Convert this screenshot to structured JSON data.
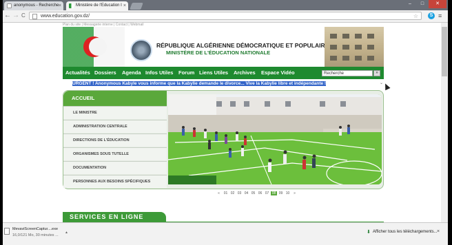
{
  "browser": {
    "tabs": [
      {
        "label": "anonymous - Recherche"
      },
      {
        "label": "Ministère de l'Education I"
      }
    ],
    "tab_close": "×",
    "new_tab": "",
    "window_controls": {
      "minimize": "–",
      "maximize": "□",
      "close": "✕"
    },
    "nav": {
      "back": "←",
      "forward": "→",
      "reload": "C"
    },
    "url": "www.education.gov.dz/",
    "bookmark_star": "☆",
    "skype": "S",
    "menu": "≡"
  },
  "site": {
    "toplinks": "Plan du site | Messagerie interne | Contact | Webmail",
    "title_line1": "République Algérienne Démocratique et Populaire",
    "title_line2": "Ministère de l'Éducation Nationale",
    "nav_items": [
      "Actualités",
      "Dossiers",
      "Agenda",
      "Infos Utiles",
      "Forum",
      "Liens Utiles",
      "Archives",
      "Espace Vidéo"
    ],
    "search_value": "Recherche",
    "search_button": "»",
    "ticker": "URGENT ! Anonymous Kabyle vous informe que la Kabylie demande le divorce... Vive la Kabylie libre et indépendante !",
    "ticker_arrow": "⌄",
    "sidebar": {
      "header": "ACCUEIL",
      "items": [
        "LE MINISTRE",
        "ADMINISTRATION CENTRALE",
        "DIRECTIONS DE L'ÉDUCATION",
        "ORGANISMES SOUS TUTELLE",
        "DOCUMENTATION",
        "PERSONNES AUX BESOINS SPÉCIFIQUES"
      ]
    },
    "pager": {
      "prev": "«",
      "pages": [
        "01",
        "02",
        "03",
        "04",
        "05",
        "06",
        "07",
        "08",
        "09",
        "10"
      ],
      "current": "08",
      "next": "»"
    },
    "services_title": "SERVICES EN LIGNE"
  },
  "downloads": {
    "file_name": "MevaviScreenCaptur....exe",
    "status": "16,0/121 Mo, 30 minutes ...",
    "arrow": "▲",
    "show_all": "Afficher tous les téléchargements...",
    "download_icon": "⬇",
    "close": "×"
  },
  "colors": {
    "brand_green": "#1e8a2f",
    "accent_green": "#5aa83b",
    "ticker_highlight": "#3465c9"
  }
}
